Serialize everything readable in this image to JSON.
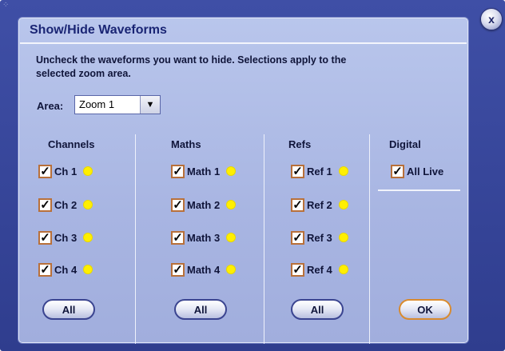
{
  "dialog": {
    "title": "Show/Hide Waveforms",
    "instructions": "Uncheck the waveforms you want to hide. Selections apply to the selected zoom area.",
    "close_label": "x",
    "area": {
      "label": "Area:",
      "value": "Zoom 1",
      "arrow": "▼"
    }
  },
  "columns": {
    "channels": {
      "header": "Channels",
      "items": [
        {
          "label": "Ch 1",
          "checked": true
        },
        {
          "label": "Ch 2",
          "checked": true
        },
        {
          "label": "Ch 3",
          "checked": true
        },
        {
          "label": "Ch 4",
          "checked": true
        }
      ],
      "all_label": "All"
    },
    "maths": {
      "header": "Maths",
      "items": [
        {
          "label": "Math 1",
          "checked": true
        },
        {
          "label": "Math 2",
          "checked": true
        },
        {
          "label": "Math 3",
          "checked": true
        },
        {
          "label": "Math 4",
          "checked": true
        }
      ],
      "all_label": "All"
    },
    "refs": {
      "header": "Refs",
      "items": [
        {
          "label": "Ref 1",
          "checked": true
        },
        {
          "label": "Ref 2",
          "checked": true
        },
        {
          "label": "Ref 3",
          "checked": true
        },
        {
          "label": "Ref 4",
          "checked": true
        }
      ],
      "all_label": "All"
    },
    "digital": {
      "header": "Digital",
      "items": [
        {
          "label": "All Live",
          "checked": true
        }
      ]
    }
  },
  "check_mark": "✓",
  "ok_label": "OK",
  "colors": {
    "frame": "#3a4aa0",
    "panel": "#b1bee7",
    "title": "#1a2574",
    "checkbox_border": "#b8703a",
    "waveform_dot": "#ffef00",
    "ok_border": "#d98b2e"
  }
}
